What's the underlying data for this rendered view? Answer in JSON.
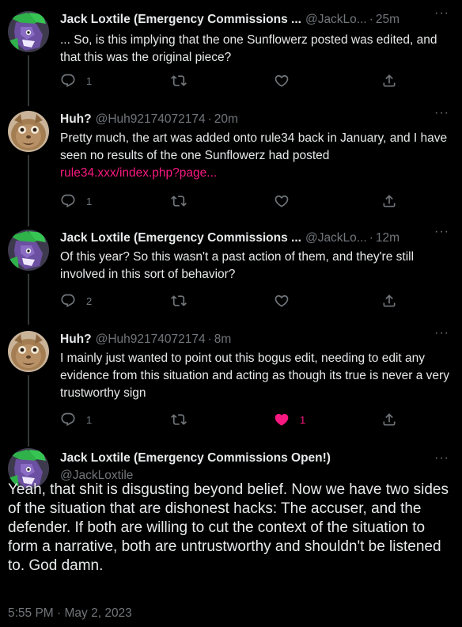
{
  "tweets": [
    {
      "name": "Jack Loxtile (Emergency Commissions ...",
      "handle": "@JackLo...",
      "time": "25m",
      "text": "... So, is this implying that the one Sunflowerz posted was edited, and that this was the original piece?",
      "link": "",
      "reply_count": "1",
      "like_count": ""
    },
    {
      "name": "Huh?",
      "handle": "@Huh92174072174",
      "time": "20m",
      "text": "Pretty much, the art was added onto rule34 back in January, and I have seen no results of the one Sunflowerz had posted",
      "link": "rule34.xxx/index.php?page...",
      "reply_count": "1",
      "like_count": ""
    },
    {
      "name": "Jack Loxtile (Emergency Commissions ...",
      "handle": "@JackLo...",
      "time": "12m",
      "text": "Of this year? So this wasn't a past action of them, and they're still involved in this sort of behavior?",
      "link": "",
      "reply_count": "2",
      "like_count": ""
    },
    {
      "name": "Huh?",
      "handle": "@Huh92174072174",
      "time": "8m",
      "text": "I mainly just wanted to point out this bogus edit, needing to edit any evidence from this situation and acting as though its true is never a very trustworthy sign",
      "link": "",
      "reply_count": "1",
      "like_count": "1"
    }
  ],
  "main": {
    "name": "Jack Loxtile (Emergency Commissions Open!)",
    "handle": "@JackLoxtile",
    "text": "Yeah, that shit is disgusting beyond belief. Now we have two sides of the situation that are dishonest hacks: The accuser, and the defender. If both are willing to cut the context of the situation to form a narrative, both are untrustworthy and shouldn't be listened to. God damn.",
    "timestamp": "5:55 PM · May 2, 2023"
  },
  "separator": "·",
  "more_glyph": "···",
  "colors": {
    "accent_like": "#f91880",
    "muted": "#71767b",
    "text": "#e7e9ea",
    "background": "#000000"
  },
  "icons": [
    "reply-icon",
    "retweet-icon",
    "like-icon",
    "share-icon",
    "more-icon"
  ]
}
